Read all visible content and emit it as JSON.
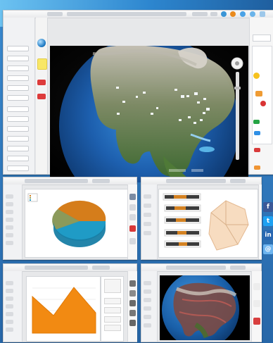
{
  "app": {
    "title": ""
  },
  "main": {
    "kind": "earth-overview"
  },
  "panels": {
    "pie": {
      "title": ""
    },
    "radar": {
      "title": ""
    },
    "area": {
      "title": ""
    },
    "earth": {
      "title": ""
    }
  },
  "colors": {
    "accent": "#2e8fd8",
    "pie_orange": "#d57d1b",
    "pie_green": "#8b9a5b",
    "pie_blue": "#1f9bc6",
    "area_orange": "#f28a12",
    "radar_fill": "#f7dcc0"
  },
  "icons": [
    "search-icon",
    "settings-icon",
    "globe-icon",
    "pie-chart-icon",
    "radar-chart-icon",
    "area-chart-icon",
    "facebook-icon",
    "twitter-icon",
    "linkedin-icon",
    "email-icon"
  ],
  "chart_data": [
    {
      "type": "pie",
      "values": [
        30,
        20,
        50
      ],
      "title": ""
    },
    {
      "type": "area",
      "values": [
        55,
        38,
        78,
        40
      ],
      "title": ""
    }
  ]
}
